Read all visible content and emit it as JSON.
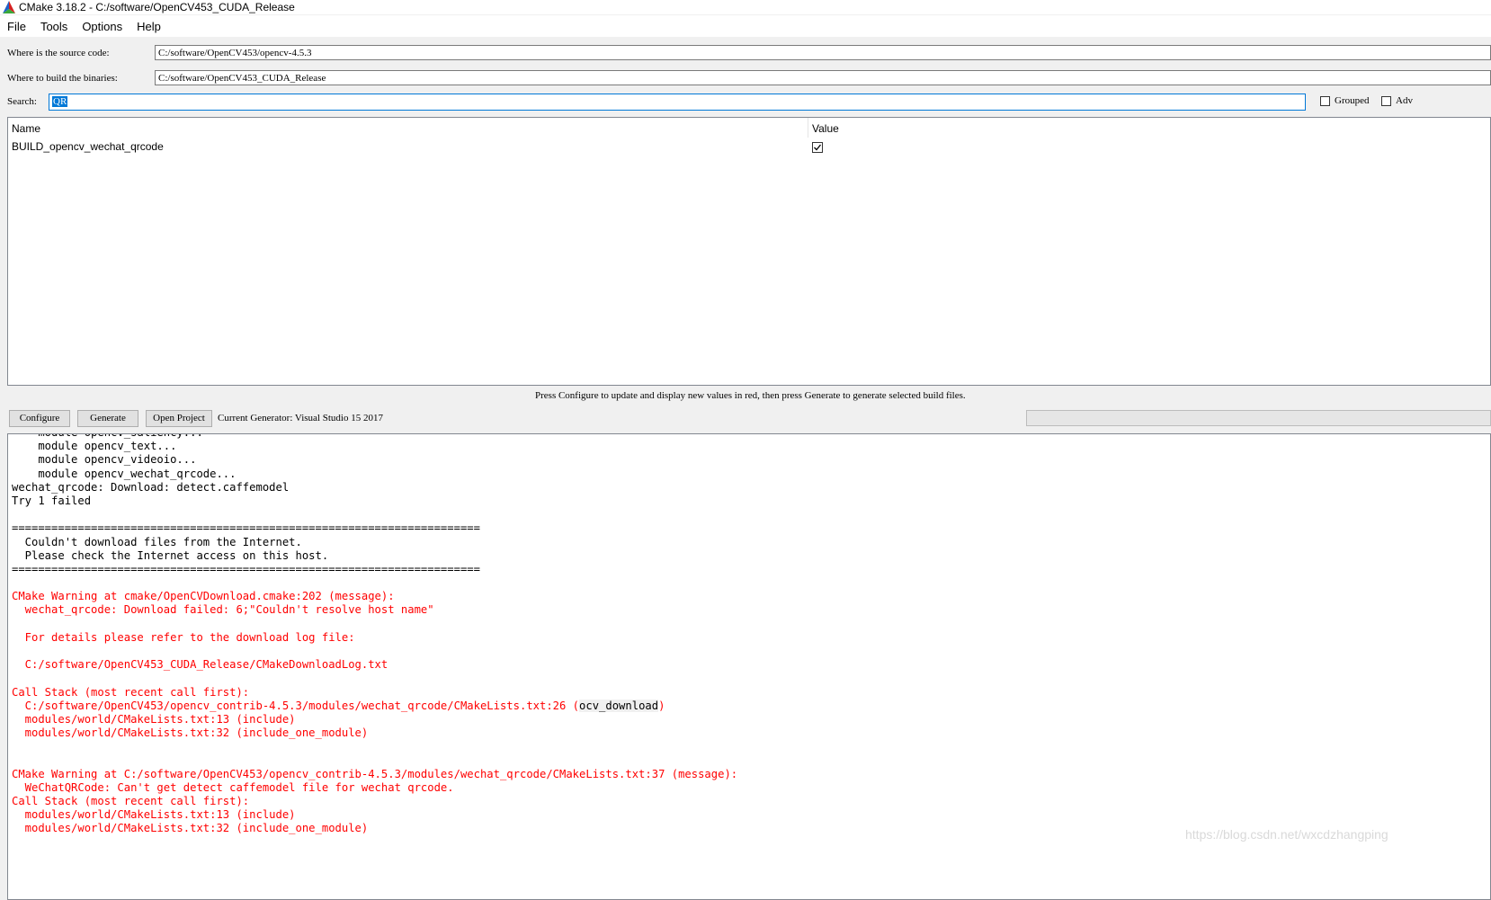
{
  "window": {
    "title": "CMake 3.18.2 - C:/software/OpenCV453_CUDA_Release"
  },
  "menu": [
    "File",
    "Tools",
    "Options",
    "Help"
  ],
  "source": {
    "label": "Where is the source code:",
    "value": "C:/software/OpenCV453/opencv-4.5.3"
  },
  "build": {
    "label": "Where to build the binaries:",
    "value": "C:/software/OpenCV453_CUDA_Release"
  },
  "search": {
    "label": "Search:",
    "value": "QR"
  },
  "options": {
    "grouped": "Grouped",
    "advanced": "Adv"
  },
  "table": {
    "headers": {
      "name": "Name",
      "value": "Value"
    },
    "rows": [
      {
        "name": "BUILD_opencv_wechat_qrcode",
        "checked": true
      }
    ]
  },
  "hint": "Press Configure to update and display new values in red, then press Generate to generate selected build files.",
  "buttons": {
    "configure": "Configure",
    "generate": "Generate",
    "open_project": "Open Project"
  },
  "generator": "Current Generator: Visual Studio 15 2017",
  "colors": {
    "warning": "#ff0000",
    "selection": "#0078d7"
  },
  "log": [
    {
      "text": "    module opencv_saliency...",
      "color": "black"
    },
    {
      "text": "    module opencv_text...",
      "color": "black"
    },
    {
      "text": "    module opencv_videoio...",
      "color": "black"
    },
    {
      "text": "    module opencv_wechat_qrcode...",
      "color": "black"
    },
    {
      "text": "wechat_qrcode: Download: detect.caffemodel",
      "color": "black"
    },
    {
      "text": "Try 1 failed",
      "color": "black"
    },
    {
      "text": "",
      "color": "black"
    },
    {
      "text": "=======================================================================",
      "color": "black"
    },
    {
      "text": "  Couldn't download files from the Internet.",
      "color": "black"
    },
    {
      "text": "  Please check the Internet access on this host.",
      "color": "black"
    },
    {
      "text": "=======================================================================",
      "color": "black"
    },
    {
      "text": "",
      "color": "black"
    },
    {
      "text": "CMake Warning at cmake/OpenCVDownload.cmake:202 (message):",
      "color": "red"
    },
    {
      "text": "  wechat_qrcode: Download failed: 6;\"Couldn't resolve host name\"",
      "color": "red"
    },
    {
      "text": "",
      "color": "red"
    },
    {
      "text": "  For details please refer to the download log file:",
      "color": "red"
    },
    {
      "text": "",
      "color": "red"
    },
    {
      "text": "  C:/software/OpenCV453_CUDA_Release/CMakeDownloadLog.txt",
      "color": "red"
    },
    {
      "text": "",
      "color": "red"
    },
    {
      "text": "Call Stack (most recent call first):",
      "color": "red"
    },
    {
      "text": "  C:/software/OpenCV453/opencv_contrib-4.5.3/modules/wechat_qrcode/CMakeLists.txt:26 (",
      "color": "red",
      "highlight": "ocv_download",
      "after": ")"
    },
    {
      "text": "  modules/world/CMakeLists.txt:13 (include)",
      "color": "red"
    },
    {
      "text": "  modules/world/CMakeLists.txt:32 (include_one_module)",
      "color": "red"
    },
    {
      "text": "",
      "color": "red"
    },
    {
      "text": "",
      "color": "red"
    },
    {
      "text": "CMake Warning at C:/software/OpenCV453/opencv_contrib-4.5.3/modules/wechat_qrcode/CMakeLists.txt:37 (message):",
      "color": "red"
    },
    {
      "text": "  WeChatQRCode: Can't get detect caffemodel file for wechat qrcode.",
      "color": "red"
    },
    {
      "text": "Call Stack (most recent call first):",
      "color": "red"
    },
    {
      "text": "  modules/world/CMakeLists.txt:13 (include)",
      "color": "red"
    },
    {
      "text": "  modules/world/CMakeLists.txt:32 (include_one_module)",
      "color": "red"
    }
  ],
  "watermark": "https://blog.csdn.net/wxcdzhangping"
}
